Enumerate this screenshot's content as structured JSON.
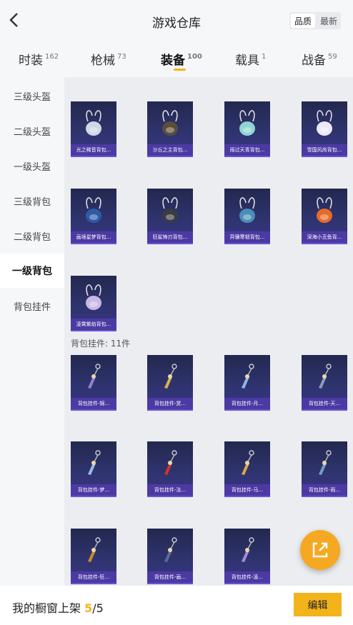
{
  "header": {
    "title": "游戏仓库",
    "sort": [
      "品质",
      "最新"
    ]
  },
  "tabs": [
    {
      "label": "时装",
      "count": "162"
    },
    {
      "label": "枪械",
      "count": "73"
    },
    {
      "label": "装备",
      "count": "100"
    },
    {
      "label": "载具",
      "count": "1"
    },
    {
      "label": "战备",
      "count": "59"
    }
  ],
  "sidebar": [
    "三级头盔",
    "二级头盔",
    "一级头盔",
    "三级背包",
    "二级背包",
    "一级背包",
    "背包挂件"
  ],
  "backpacks": [
    {
      "label": "光之稀音背包..."
    },
    {
      "label": "沙丘之主背包..."
    },
    {
      "label": "雨过天青背包..."
    },
    {
      "label": "雪国风尚背包..."
    },
    {
      "label": "画境星梦背包..."
    },
    {
      "label": "狂鲨锋刃背包..."
    },
    {
      "label": "异骥寒韧背包..."
    },
    {
      "label": "深海小丑鱼背..."
    },
    {
      "label": "凌霄紫焰背包..."
    }
  ],
  "pendant_section": "背包挂件: 11件",
  "pendants": [
    {
      "label": "背包挂件-锦..."
    },
    {
      "label": "背包挂件-赏..."
    },
    {
      "label": "背包挂件-月..."
    },
    {
      "label": "背包挂件-天..."
    },
    {
      "label": "背包挂件-梦..."
    },
    {
      "label": "背包挂件-法..."
    },
    {
      "label": "背包挂件-马..."
    },
    {
      "label": "背包挂件-雨..."
    },
    {
      "label": "背包挂件-狂..."
    },
    {
      "label": "背包挂件-画..."
    },
    {
      "label": "背包挂件-凌..."
    }
  ],
  "bottom": {
    "showcase_label": "我的橱窗上架",
    "current": "5",
    "total": "/5",
    "edit": "编辑"
  },
  "icons": {
    "back": "back-arrow-icon",
    "share": "share-icon"
  },
  "colors": {
    "accent": "#f3b31b",
    "card_bg": "#2f3470",
    "card_label_bg": "#4c3aa3"
  }
}
